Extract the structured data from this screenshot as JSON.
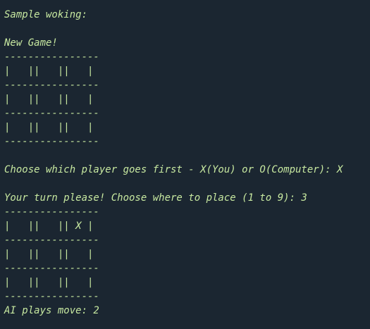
{
  "terminal": {
    "lines": [
      "'''",
      "Sample woking:",
      "",
      "New Game!",
      "----------------",
      "|   ||   ||   |",
      "----------------",
      "|   ||   ||   |",
      "----------------",
      "|   ||   ||   |",
      "----------------",
      "",
      "Choose which player goes first - X(You) or O(Computer): X",
      "",
      "Your turn please! Choose where to place (1 to 9): 3",
      "----------------",
      "|   ||   || X |",
      "----------------",
      "|   ||   ||   |",
      "----------------",
      "|   ||   ||   |",
      "----------------",
      "AI plays move: 2"
    ]
  },
  "colors": {
    "background": "#1b2631",
    "text": "#c7e8a0"
  }
}
